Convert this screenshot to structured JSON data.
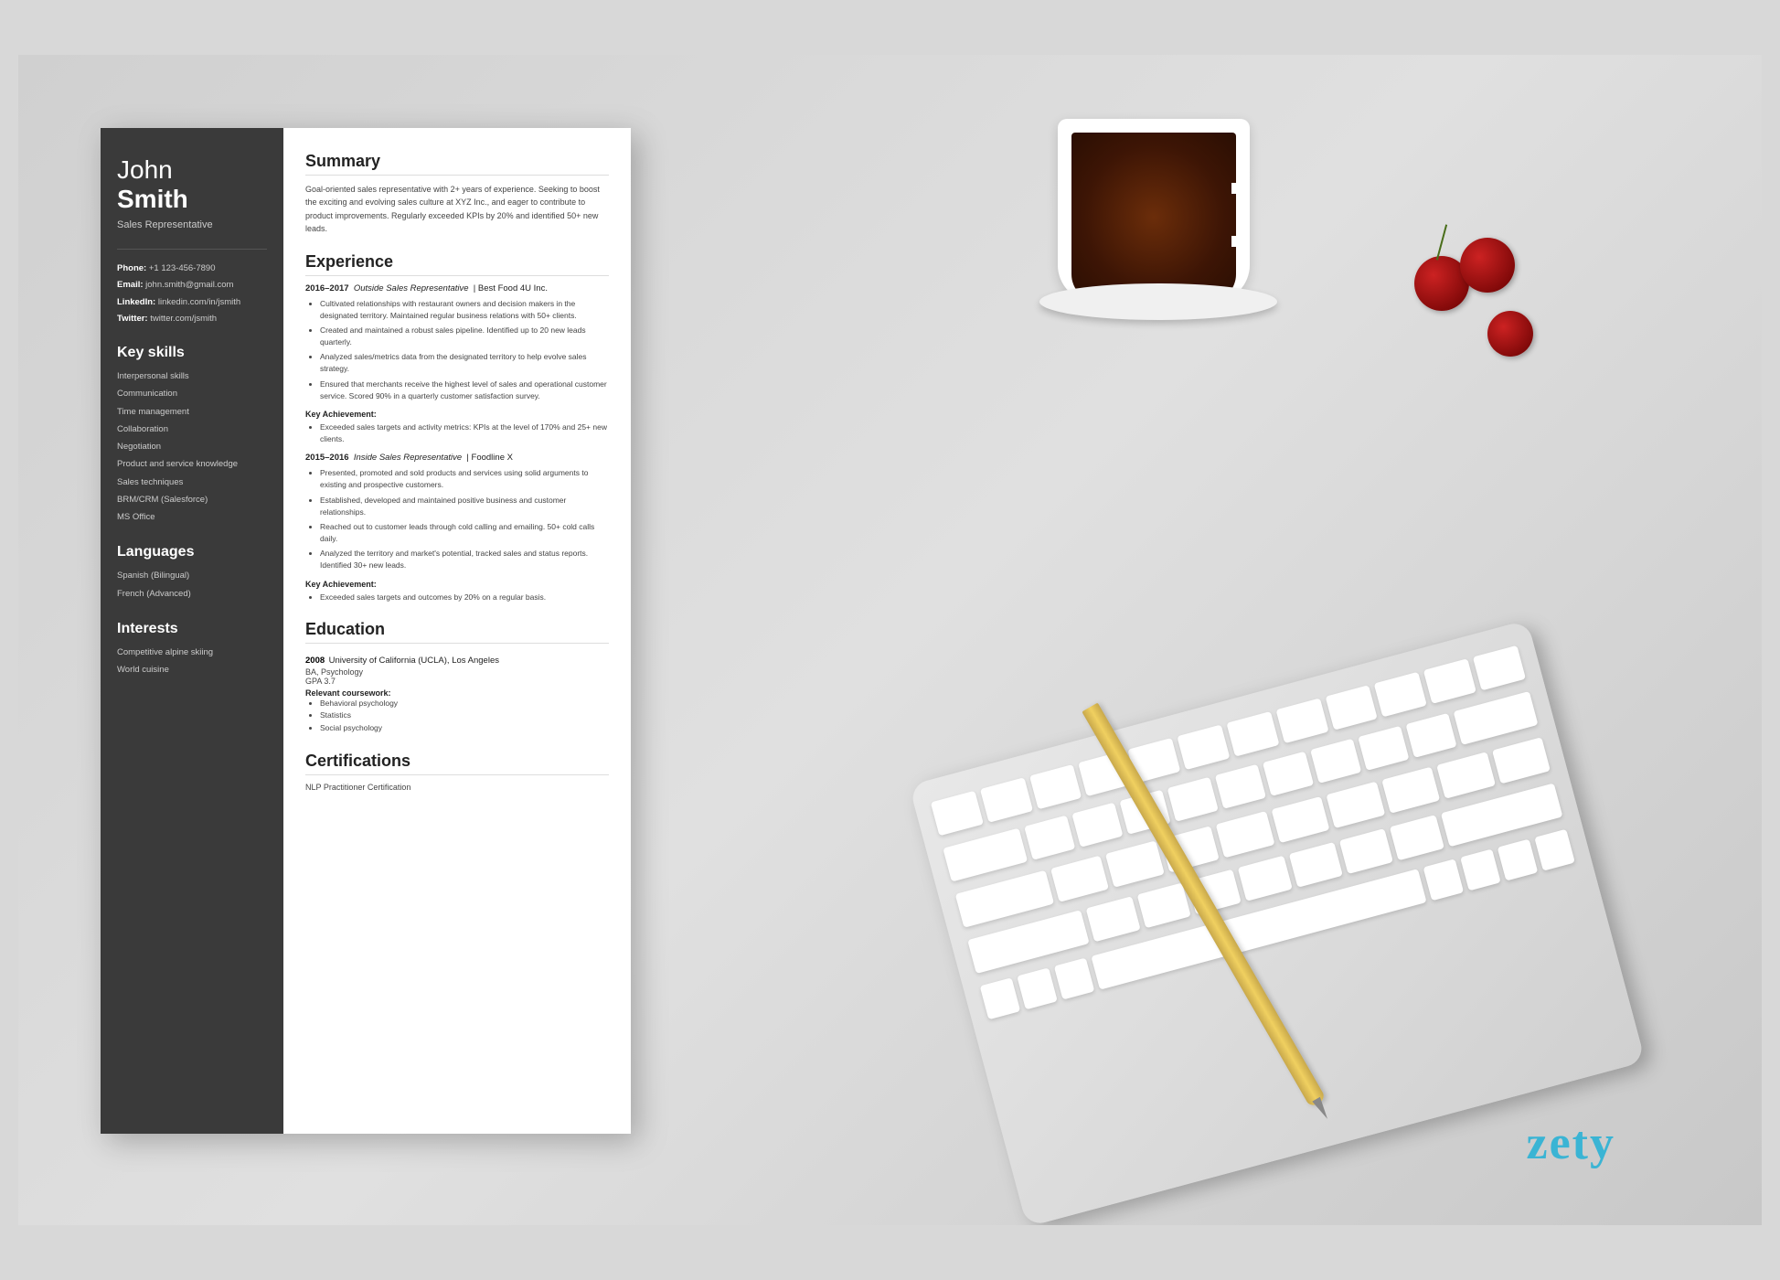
{
  "page": {
    "brand": "zety",
    "background_color": "#c8c8c8"
  },
  "resume": {
    "sidebar": {
      "name_first": "John ",
      "name_last": "Smith",
      "title": "Sales Representative",
      "contact": [
        {
          "label": "Phone:",
          "value": "+1 123-456-7890"
        },
        {
          "label": "Email:",
          "value": "john.smith@gmail.com"
        },
        {
          "label": "LinkedIn:",
          "value": "linkedin.com/in/jsmith"
        },
        {
          "label": "Twitter:",
          "value": "twitter.com/jsmith"
        }
      ],
      "skills_title": "Key skills",
      "skills": [
        "Interpersonal skills",
        "Communication",
        "Time management",
        "Collaboration",
        "Negotiation",
        "Product and service knowledge",
        "Sales techniques",
        "BRM/CRM (Salesforce)",
        "MS Office"
      ],
      "languages_title": "Languages",
      "languages": [
        "Spanish (Bilingual)",
        "French (Advanced)"
      ],
      "interests_title": "Interests",
      "interests": [
        "Competitive alpine skiing",
        "World cuisine"
      ]
    },
    "main": {
      "summary_title": "Summary",
      "summary_text": "Goal-oriented sales representative with 2+ years of experience. Seeking to boost the exciting and evolving sales culture at XYZ Inc., and eager to contribute to product improvements. Regularly exceeded KPIs by 20% and identified 50+ new leads.",
      "experience_title": "Experience",
      "jobs": [
        {
          "years": "2016–2017",
          "role": "Outside Sales Representative",
          "company": "Best Food 4U Inc.",
          "bullets": [
            "Cultivated relationships with restaurant owners and decision makers in the designated territory. Maintained regular business relations with 50+ clients.",
            "Created and maintained a robust sales pipeline. Identified up to 20 new leads quarterly.",
            "Analyzed sales/metrics data from the designated territory to help evolve sales strategy.",
            "Ensured that merchants receive the highest level of sales and operational customer service. Scored 90% in a quarterly customer satisfaction survey."
          ],
          "achievement_label": "Key Achievement:",
          "achievement": "Exceeded sales targets and activity metrics: KPIs at the level of 170% and 25+ new clients."
        },
        {
          "years": "2015–2016",
          "role": "Inside Sales Representative",
          "company": "Foodline X",
          "bullets": [
            "Presented, promoted and sold products and services using solid arguments to existing and prospective customers.",
            "Established, developed and maintained positive business and customer relationships.",
            "Reached out to customer leads through cold calling and emailing. 50+ cold calls daily.",
            "Analyzed the territory and market's potential, tracked sales and status reports. Identified 30+ new leads."
          ],
          "achievement_label": "Key Achievement:",
          "achievement": "Exceeded sales targets and outcomes by 20% on a regular basis."
        }
      ],
      "education_title": "Education",
      "education": [
        {
          "year": "2008",
          "school": "University of California (UCLA), Los Angeles",
          "degree": "BA, Psychology",
          "gpa": "GPA 3.7",
          "coursework_label": "Relevant coursework:",
          "coursework": [
            "Behavioral psychology",
            "Statistics",
            "Social psychology"
          ]
        }
      ],
      "certifications_title": "Certifications",
      "certifications": [
        "NLP Practitioner Certification"
      ]
    }
  }
}
